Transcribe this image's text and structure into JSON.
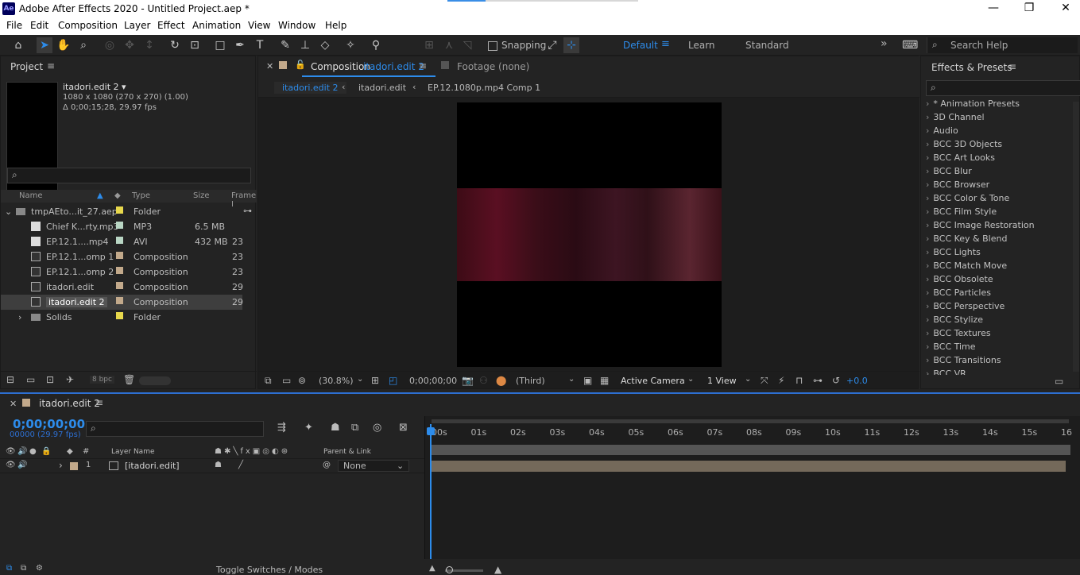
{
  "window": {
    "title": "Adobe After Effects 2020 - Untitled Project.aep *",
    "logo": "Ae",
    "minimize": "—",
    "restore": "❐",
    "close": "✕"
  },
  "menu": [
    "File",
    "Edit",
    "Composition",
    "Layer",
    "Effect",
    "Animation",
    "View",
    "Window",
    "Help"
  ],
  "toolbar": {
    "snapping_label": "Snapping",
    "workspaces": [
      "Default",
      "Learn",
      "Standard"
    ],
    "active_workspace": "Default",
    "more": "»",
    "search_help_placeholder": "Search Help"
  },
  "project": {
    "panel_title": "Project",
    "selected_name": "itadori.edit 2 ▾",
    "selected_dims": "1080 x 1080  (270 x 270) (1.00)",
    "selected_duration": "Δ 0;00;15;28, 29.97 fps",
    "search_placeholder": "",
    "columns": {
      "name": "Name",
      "type": "Type",
      "size": "Size",
      "frame": "Frame I"
    },
    "items": [
      {
        "name": "tmpAEto...it_27.aep",
        "type": "Folder",
        "size": "",
        "frame": "",
        "label": "#e8d84c",
        "icon": "folder",
        "indent": 0,
        "expanded": "⌄"
      },
      {
        "name": "Chief K...rty.mp3",
        "type": "MP3",
        "size": "6.5 MB",
        "frame": "",
        "label": "#b9d6c4",
        "icon": "audio",
        "indent": 1,
        "expanded": ""
      },
      {
        "name": "EP.12.1....mp4",
        "type": "AVI",
        "size": "432 MB",
        "frame": "23",
        "label": "#b9d6c4",
        "icon": "video",
        "indent": 1,
        "expanded": ""
      },
      {
        "name": "EP.12.1...omp 1",
        "type": "Composition",
        "size": "",
        "frame": "23",
        "label": "#c2a98b",
        "icon": "comp",
        "indent": 1,
        "expanded": ""
      },
      {
        "name": "EP.12.1...omp 2",
        "type": "Composition",
        "size": "",
        "frame": "23",
        "label": "#c2a98b",
        "icon": "comp",
        "indent": 1,
        "expanded": ""
      },
      {
        "name": "itadori.edit",
        "type": "Composition",
        "size": "",
        "frame": "29",
        "label": "#c2a98b",
        "icon": "comp",
        "indent": 1,
        "expanded": ""
      },
      {
        "name": "itadori.edit 2",
        "type": "Composition",
        "size": "",
        "frame": "29",
        "label": "#c2a98b",
        "icon": "comp",
        "indent": 1,
        "expanded": "",
        "selected": true
      },
      {
        "name": "Solids",
        "type": "Folder",
        "size": "",
        "frame": "",
        "label": "#e8d84c",
        "icon": "folder",
        "indent": 1,
        "expanded": "›"
      }
    ],
    "bpc": "8 bpc"
  },
  "comp": {
    "tab_prefix": "Composition",
    "tab_name": "itadori.edit 2",
    "footage_tab": "Footage  (none)",
    "breadcrumbs": [
      "itadori.edit 2",
      "itadori.edit",
      "EP.12.1080p.mp4 Comp 1"
    ],
    "zoom": "(30.8%)",
    "timecode": "0;00;00;00",
    "resolution": "(Third)",
    "camera": "Active Camera",
    "views": "1 View",
    "exposure": "+0.0"
  },
  "effects": {
    "panel_title": "Effects & Presets",
    "search_placeholder": "",
    "items": [
      "* Animation Presets",
      "3D Channel",
      "Audio",
      "BCC 3D Objects",
      "BCC Art Looks",
      "BCC Blur",
      "BCC Browser",
      "BCC Color & Tone",
      "BCC Film Style",
      "BCC Image Restoration",
      "BCC Key & Blend",
      "BCC Lights",
      "BCC Match Move",
      "BCC Obsolete",
      "BCC Particles",
      "BCC Perspective",
      "BCC Stylize",
      "BCC Textures",
      "BCC Time",
      "BCC Transitions",
      "BCC VR"
    ]
  },
  "timeline": {
    "tab_name": "itadori.edit 2",
    "timecode": "0;00;00;00",
    "frame_info": "00000 (29.97 fps)",
    "col_layer_name": "Layer Name",
    "col_parent": "Parent & Link",
    "ruler": [
      "00s",
      "01s",
      "02s",
      "03s",
      "04s",
      "05s",
      "06s",
      "07s",
      "08s",
      "09s",
      "10s",
      "11s",
      "12s",
      "13s",
      "14s",
      "15s",
      "16"
    ],
    "layers": [
      {
        "num": "1",
        "name": "[itadori.edit]",
        "parent": "None",
        "label": "#c2a98b"
      }
    ],
    "toggle_label": "Toggle Switches / Modes"
  }
}
